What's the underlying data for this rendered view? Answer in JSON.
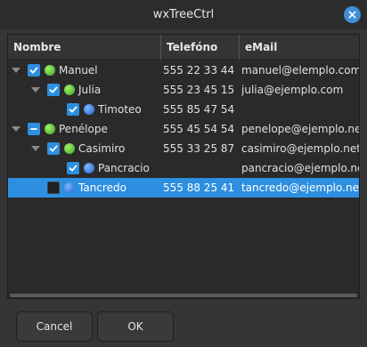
{
  "window": {
    "title": "wxTreeCtrl"
  },
  "colors": {
    "accent": "#2d8fe0",
    "selection": "#2d8fe0",
    "green_bullet": "#4cc42a",
    "blue_bullet": "#2f6fe0"
  },
  "icons": {
    "close": "close-icon",
    "expander": "triangle-down-icon",
    "check": "checkmark-icon",
    "partial": "dash-icon",
    "bullet_green": "green-bullet-icon",
    "bullet_blue": "blue-bullet-icon"
  },
  "columns": [
    "Nombre",
    "Telefóno",
    "eMail"
  ],
  "rows": [
    {
      "name": "Manuel",
      "phone": "555 22 33 44",
      "email": "manuel@elemplo.com",
      "level": 0,
      "expanded": true,
      "check": "checked",
      "bullet": "green",
      "selected": false
    },
    {
      "name": "Julia",
      "phone": "555 23 45 15",
      "email": "julia@ejemplo.com",
      "level": 1,
      "expanded": true,
      "check": "checked",
      "bullet": "green",
      "selected": false
    },
    {
      "name": "Timoteo",
      "phone": "555 85 47 54",
      "email": "",
      "level": 2,
      "expanded": false,
      "check": "checked",
      "bullet": "blue",
      "selected": false
    },
    {
      "name": "Penélope",
      "phone": "555 45 54 54",
      "email": "penelope@ejemplo.net",
      "level": 0,
      "expanded": true,
      "check": "partial",
      "bullet": "green",
      "selected": false
    },
    {
      "name": "Casimiro",
      "phone": "555 33 25 87",
      "email": "casimiro@ejemplo.net",
      "level": 1,
      "expanded": true,
      "check": "checked",
      "bullet": "green",
      "selected": false
    },
    {
      "name": "Pancracio",
      "phone": "",
      "email": "pancracio@ejemplo.net",
      "level": 2,
      "expanded": false,
      "check": "checked",
      "bullet": "blue",
      "selected": false
    },
    {
      "name": "Tancredo",
      "phone": "555 88 25 41",
      "email": "tancredo@ejemplo.net",
      "level": 1,
      "expanded": false,
      "check": "unchecked",
      "bullet": "blue",
      "selected": true
    }
  ],
  "buttons": {
    "cancel": "Cancel",
    "ok": "OK"
  }
}
